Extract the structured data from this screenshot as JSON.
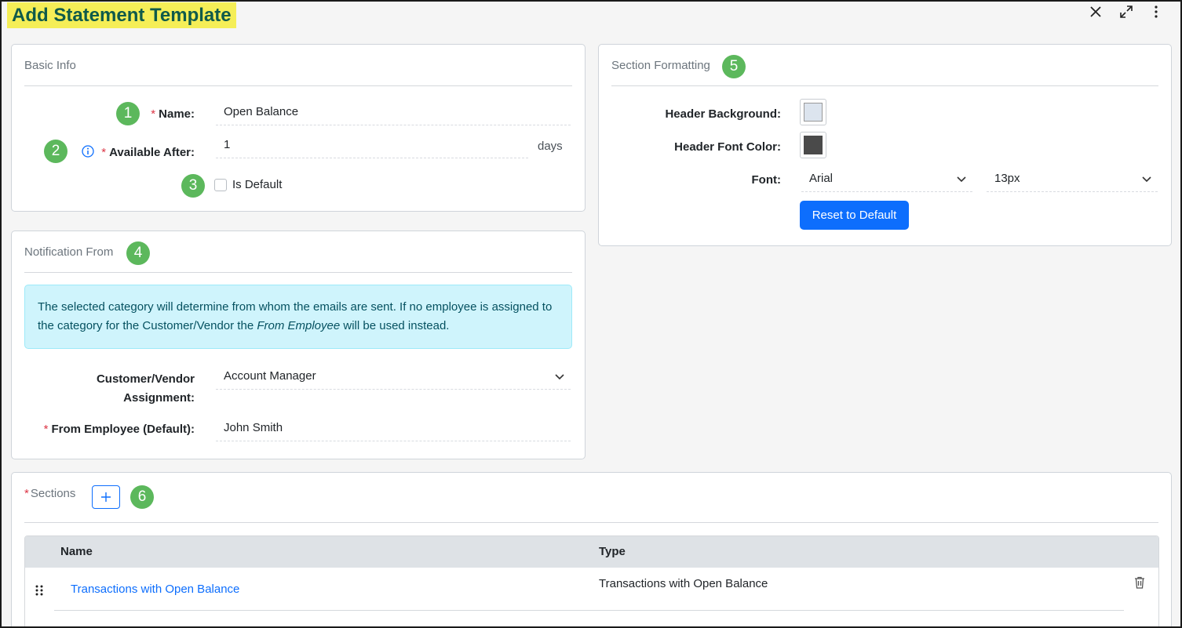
{
  "header": {
    "title": "Add Statement Template",
    "close_icon": "close-icon",
    "expand_icon": "expand-icon",
    "menu_icon": "more-vertical-icon"
  },
  "basic_info": {
    "title": "Basic Info",
    "name_label": "Name:",
    "name_value": "Open Balance",
    "available_after_label": "Available After:",
    "available_after_value": "1",
    "available_after_unit": "days",
    "is_default_label": "Is Default",
    "is_default_checked": false,
    "required_mark": "*"
  },
  "notification_from": {
    "title": "Notification From",
    "info_text_1": "The selected category will determine from whom the emails are sent. If no employee is assigned to the category for the Customer/Vendor the ",
    "info_text_emphasis": "From Employee",
    "info_text_2": " will be used instead.",
    "assignment_label_1": "Customer/Vendor",
    "assignment_label_2": "Assignment:",
    "assignment_value": "Account Manager",
    "from_employee_label": "From Employee (Default):",
    "from_employee_value": "John Smith"
  },
  "section_formatting": {
    "title": "Section Formatting",
    "header_bg_label": "Header Background:",
    "header_bg_color": "#dce4ee",
    "header_font_label": "Header Font Color:",
    "header_font_color": "#4a4a4a",
    "font_label": "Font:",
    "font_value": "Arial",
    "size_value": "13px",
    "reset_label": "Reset to Default"
  },
  "sections": {
    "title": "Sections",
    "columns": [
      "Name",
      "Type"
    ],
    "rows": [
      {
        "name": "Transactions with Open Balance",
        "type": "Transactions with Open Balance"
      }
    ]
  },
  "badges": [
    "1",
    "2",
    "3",
    "4",
    "5",
    "6"
  ],
  "colors": {
    "badge": "#5cb85c",
    "primary": "#0d6efd",
    "title_highlight": "#f5ee57",
    "title_text": "#0f5a4a"
  }
}
